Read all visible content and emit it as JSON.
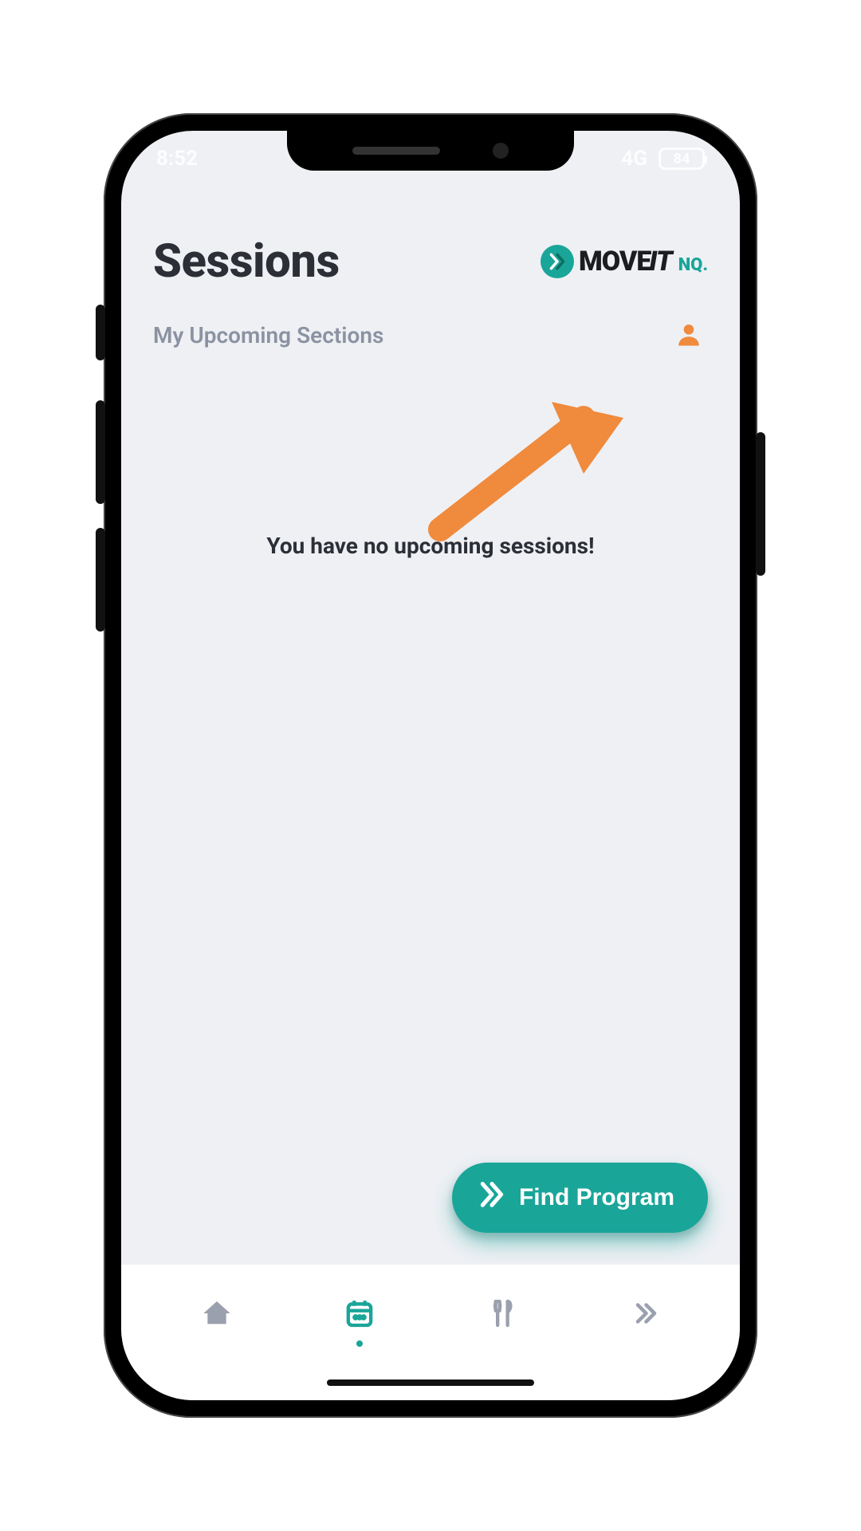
{
  "status": {
    "time": "8:52",
    "network": "4G",
    "battery": "84"
  },
  "header": {
    "title": "Sessions",
    "brand_move": "MOVE",
    "brand_it": "IT",
    "brand_nq": "NQ."
  },
  "subheader": {
    "subtitle": "My Upcoming Sections"
  },
  "main": {
    "empty_message": "You have no upcoming sessions!"
  },
  "fab": {
    "label": "Find Program"
  },
  "colors": {
    "accent": "#1aa599",
    "highlight": "#f08a3c"
  }
}
